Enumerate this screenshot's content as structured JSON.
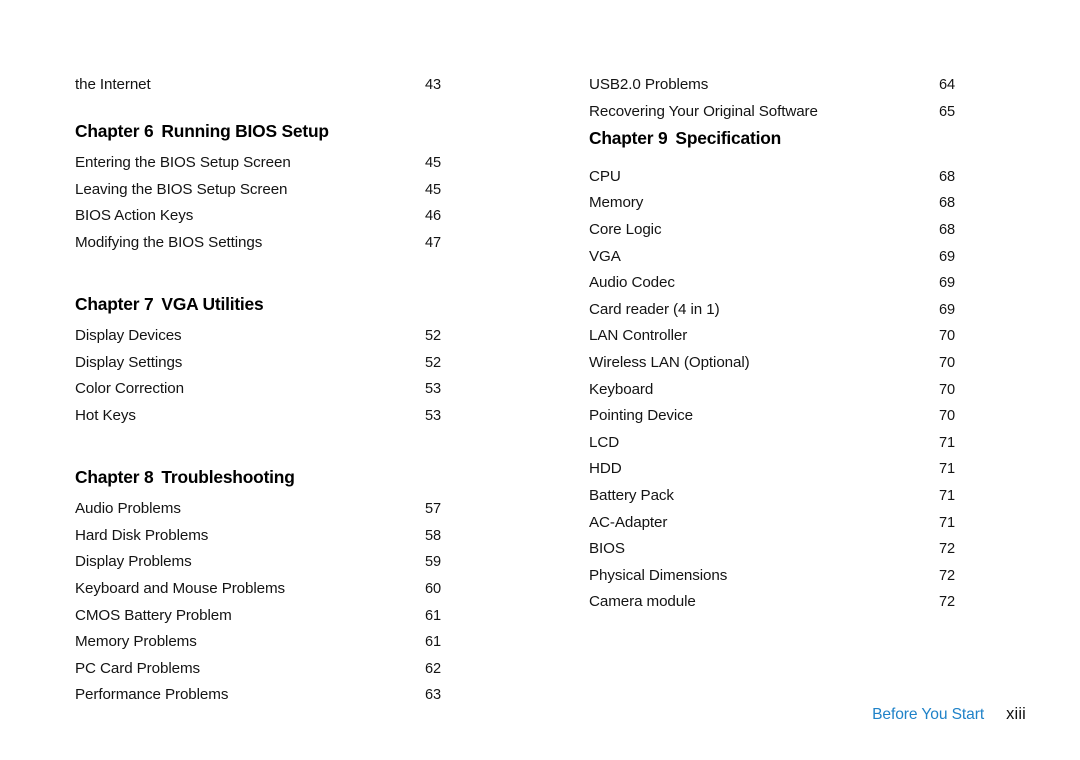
{
  "document": {
    "kind": "table-of-contents",
    "background_color": "#ffffff",
    "text_color": "#141414"
  },
  "left_column": {
    "blocks": [
      {
        "type": "entry",
        "label": "the Internet",
        "page": "43"
      },
      {
        "type": "heading",
        "chapter": "Chapter 6",
        "title": "Running BIOS Setup"
      },
      {
        "type": "entry",
        "label": "Entering the BIOS Setup Screen",
        "page": "45"
      },
      {
        "type": "entry",
        "label": "Leaving the BIOS Setup Screen",
        "page": "45"
      },
      {
        "type": "entry",
        "label": "BIOS Action Keys",
        "page": "46"
      },
      {
        "type": "entry",
        "label": "Modifying the BIOS Settings",
        "page": "47"
      },
      {
        "type": "heading",
        "chapter": "Chapter 7",
        "title": "VGA Utilities"
      },
      {
        "type": "entry",
        "label": "Display Devices",
        "page": "52"
      },
      {
        "type": "entry",
        "label": "Display Settings",
        "page": "52"
      },
      {
        "type": "entry",
        "label": "Color Correction",
        "page": "53"
      },
      {
        "type": "entry",
        "label": "Hot Keys",
        "page": "53"
      },
      {
        "type": "heading",
        "chapter": "Chapter 8",
        "title": "Troubleshooting"
      },
      {
        "type": "entry",
        "label": "Audio Problems",
        "page": "57"
      },
      {
        "type": "entry",
        "label": "Hard Disk Problems",
        "page": "58"
      },
      {
        "type": "entry",
        "label": "Display Problems",
        "page": "59"
      },
      {
        "type": "entry",
        "label": "Keyboard and Mouse Problems",
        "page": "60"
      },
      {
        "type": "entry",
        "label": "CMOS Battery Problem",
        "page": "61"
      },
      {
        "type": "entry",
        "label": "Memory Problems",
        "page": "61"
      },
      {
        "type": "entry",
        "label": "PC Card Problems",
        "page": "62"
      },
      {
        "type": "entry",
        "label": "Performance Problems",
        "page": "63"
      }
    ]
  },
  "right_column": {
    "blocks": [
      {
        "type": "entry",
        "label": "USB2.0 Problems",
        "page": "64"
      },
      {
        "type": "entry",
        "label": "Recovering Your Original Software",
        "page": "65"
      },
      {
        "type": "heading",
        "chapter": "Chapter 9",
        "title": "Specification"
      },
      {
        "type": "entry",
        "label": "CPU",
        "page": "68"
      },
      {
        "type": "entry",
        "label": "Memory",
        "page": "68"
      },
      {
        "type": "entry",
        "label": "Core Logic",
        "page": "68"
      },
      {
        "type": "entry",
        "label": "VGA",
        "page": "69"
      },
      {
        "type": "entry",
        "label": "Audio Codec",
        "page": "69"
      },
      {
        "type": "entry",
        "label": "Card reader (4 in 1)",
        "page": "69"
      },
      {
        "type": "entry",
        "label": "LAN Controller",
        "page": "70"
      },
      {
        "type": "entry",
        "label": "Wireless LAN (Optional)",
        "page": "70"
      },
      {
        "type": "entry",
        "label": "Keyboard",
        "page": "70"
      },
      {
        "type": "entry",
        "label": "Pointing Device",
        "page": "70"
      },
      {
        "type": "entry",
        "label": "LCD",
        "page": "71"
      },
      {
        "type": "entry",
        "label": "HDD",
        "page": "71"
      },
      {
        "type": "entry",
        "label": "Battery Pack",
        "page": "71"
      },
      {
        "type": "entry",
        "label": "AC-Adapter",
        "page": "71"
      },
      {
        "type": "entry",
        "label": "BIOS",
        "page": "72"
      },
      {
        "type": "entry",
        "label": "Physical Dimensions",
        "page": "72"
      },
      {
        "type": "entry",
        "label": "Camera module",
        "page": "72"
      }
    ]
  },
  "footer": {
    "section_label": "Before You Start",
    "section_label_color": "#1f82c8",
    "page_number": "xiii"
  }
}
